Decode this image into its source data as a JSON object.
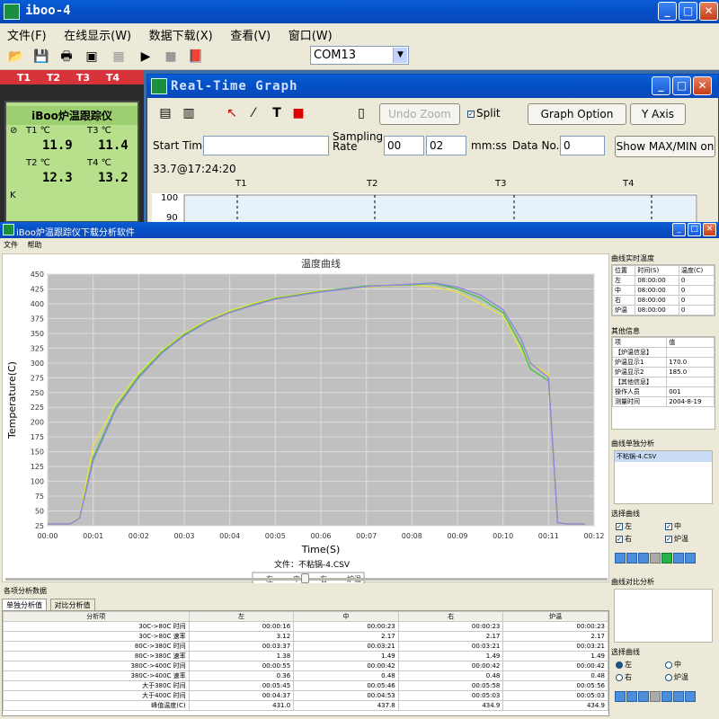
{
  "main_window": {
    "title": "iboo-4",
    "menu": [
      "文件(F)",
      "在线显示(W)",
      "数据下载(X)",
      "查看(V)",
      "窗口(W)"
    ],
    "port_combo": "COM13"
  },
  "device": {
    "tabs": [
      "T1",
      "T2",
      "T3",
      "T4"
    ],
    "lcd_title": "iBoo炉温跟踪仪",
    "readings": [
      {
        "label": "T1 ℃",
        "value": "11.9"
      },
      {
        "label": "T3 ℃",
        "value": "11.4"
      },
      {
        "label": "T2 ℃",
        "value": "12.3"
      },
      {
        "label": "T4 ℃",
        "value": "13.2"
      }
    ],
    "k_label": "K"
  },
  "realtime": {
    "title": "Real-Time Graph",
    "undo_zoom": "Undo Zoom",
    "split": "Split",
    "graph_option": "Graph Option",
    "y_axis": "Y Axis",
    "start_time_label": "Start Time",
    "sampling_rate_label": "Sampling Rate",
    "rate_a": "00",
    "rate_b": "02",
    "rate_unit": "mm:ss",
    "data_no_label": "Data No.",
    "data_no_value": "0",
    "show_maxmin": "Show MAX/MIN on",
    "status": "33.7@17:24:20",
    "channels": [
      "T1",
      "T2",
      "T3",
      "T4"
    ],
    "y_ticks": [
      "100",
      "90"
    ]
  },
  "analysis": {
    "title": "iBoo炉温跟踪仪下载分析软件",
    "menu": [
      "文件",
      "帮助"
    ],
    "file_caption": "文件：不粘锅-4.CSV",
    "section_label": "各项分析数据",
    "tabs": [
      "单独分析值",
      "对比分析值"
    ],
    "table_headers": [
      "分析项",
      "左",
      "中",
      "右",
      "炉温"
    ],
    "table_rows": [
      [
        "30C->80C 时间",
        "00:00:16",
        "00:00:23",
        "00:00:23",
        "00:00:23"
      ],
      [
        "30C->80C 速率",
        "3.12",
        "2.17",
        "2.17",
        "2.17"
      ],
      [
        "80C->380C 时间",
        "00:03:37",
        "00:03:21",
        "00:03:21",
        "00:03:21"
      ],
      [
        "80C->380C 速率",
        "1.38",
        "1.49",
        "1.49",
        "1.49"
      ],
      [
        "380C->400C 时间",
        "00:00:55",
        "00:00:42",
        "00:00:42",
        "00:00:42"
      ],
      [
        "380C->400C 速率",
        "0.36",
        "0.48",
        "0.48",
        "0.48"
      ],
      [
        "大于380C 时间",
        "00:05:45",
        "00:05:46",
        "00:05:58",
        "00:05:56"
      ],
      [
        "大于400C 时间",
        "00:04:37",
        "00:04:53",
        "00:05:03",
        "00:05:03"
      ],
      [
        "峰值温度(C)",
        "431.0",
        "437.8",
        "434.9",
        "434.9"
      ]
    ],
    "side": {
      "realtime_title": "曲线实时温度",
      "realtime_headers": [
        "位置",
        "时间(S)",
        "温度(C)"
      ],
      "realtime_rows": [
        [
          "左",
          "08:00:00",
          "0"
        ],
        [
          "中",
          "08:00:00",
          "0"
        ],
        [
          "右",
          "08:00:00",
          "0"
        ],
        [
          "炉温",
          "08:00:00",
          "0"
        ]
      ],
      "info_title": "其他信息",
      "info_headers": [
        "项",
        "值"
      ],
      "info_rows": [
        [
          "【炉温信息】",
          ""
        ],
        [
          "炉温显示1",
          "170.0"
        ],
        [
          "炉温显示2",
          "185.0"
        ],
        [
          "【其他信息】",
          ""
        ],
        [
          "操作人员",
          "001"
        ],
        [
          "测量时间",
          "2004-8-19"
        ]
      ],
      "single_title": "曲线单独分析",
      "single_file": "不粘锅-4.CSV",
      "select_title": "选择曲线",
      "curves": [
        "左",
        "中",
        "右",
        "炉温"
      ],
      "compare_title": "曲线对比分析",
      "select_title2": "选择曲线",
      "radios": [
        "左",
        "中",
        "右",
        "炉温"
      ]
    }
  },
  "chart_data": {
    "type": "line",
    "title": "温度曲线",
    "xlabel": "Time(S)",
    "ylabel": "Temperature(C)",
    "ylim": [
      25,
      450
    ],
    "xlim_minutes": [
      0,
      12
    ],
    "x_ticks": [
      "00:00",
      "00:01",
      "00:02",
      "00:03",
      "00:04",
      "00:05",
      "00:06",
      "00:07",
      "00:08",
      "00:09",
      "00:10",
      "00:11",
      "00:12"
    ],
    "y_ticks": [
      25,
      50,
      75,
      100,
      125,
      150,
      175,
      200,
      225,
      250,
      275,
      300,
      325,
      350,
      375,
      400,
      425,
      450
    ],
    "grid": true,
    "legend": [
      "左",
      "中",
      "右",
      "炉温"
    ],
    "series_colors": [
      "#e8e43a",
      "#3ec43e",
      "#f06a5a",
      "#8a8ae8"
    ],
    "x_minutes": [
      0,
      0.5,
      0.7,
      1.0,
      1.5,
      2.0,
      2.5,
      3.0,
      3.5,
      4.0,
      4.5,
      5.0,
      6.0,
      7.0,
      8.0,
      8.5,
      9.0,
      9.5,
      10.0,
      10.4,
      10.6,
      11.0,
      11.2,
      11.4,
      11.8
    ],
    "series": [
      {
        "name": "左",
        "values": [
          28,
          28,
          40,
          160,
          232,
          282,
          320,
          350,
          372,
          388,
          400,
          410,
          422,
          428,
          432,
          428,
          420,
          400,
          380,
          320,
          300,
          280,
          30,
          28,
          28
        ]
      },
      {
        "name": "中",
        "values": [
          28,
          28,
          38,
          140,
          225,
          278,
          318,
          348,
          370,
          386,
          398,
          409,
          421,
          430,
          432,
          434,
          425,
          410,
          385,
          330,
          290,
          270,
          30,
          28,
          28
        ]
      },
      {
        "name": "右",
        "values": [
          28,
          28,
          38,
          135,
          222,
          275,
          316,
          346,
          369,
          385,
          397,
          408,
          420,
          429,
          433,
          435,
          428,
          415,
          390,
          340,
          300,
          275,
          30,
          28,
          28
        ]
      },
      {
        "name": "炉温",
        "values": [
          28,
          28,
          38,
          135,
          222,
          275,
          316,
          346,
          369,
          385,
          397,
          408,
          420,
          429,
          433,
          435,
          428,
          415,
          390,
          340,
          300,
          275,
          30,
          28,
          28
        ]
      }
    ]
  }
}
